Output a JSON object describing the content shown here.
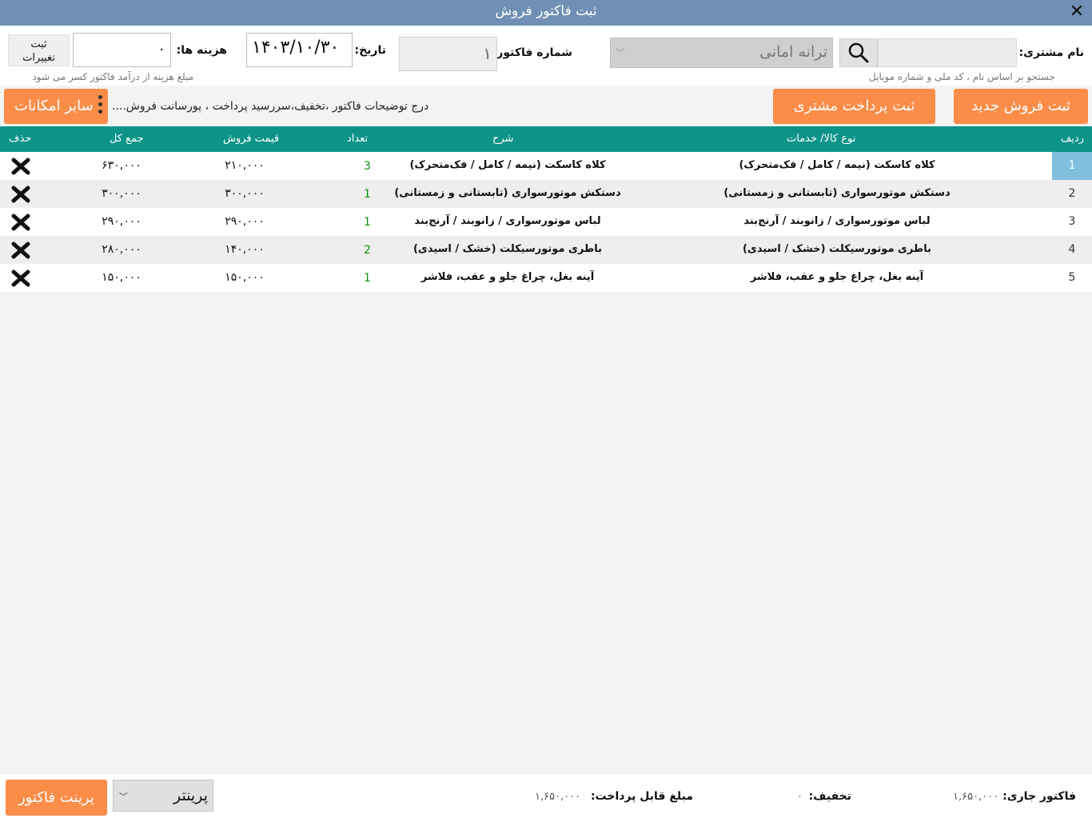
{
  "window": {
    "title": "ثبت فاکتور فروش",
    "close_label": "✕"
  },
  "customer": {
    "label": "نام مشتری:",
    "search_value": "",
    "search_hint": "جستجو بر اساس نام ، کد ملی و شماره موبایل",
    "selected": "ترانه امانی"
  },
  "invoice": {
    "number_label": "شماره فاکتور:",
    "number": "۱"
  },
  "date": {
    "label": "تاریخ:",
    "value": "۱۴۰۳/۱۰/۳۰"
  },
  "costs": {
    "label": "هزینه ها:",
    "value": "۰",
    "hint": "مبلغ هزینه از درآمد فاکتور کسر می شود"
  },
  "save_changes": {
    "line1": "ثبت",
    "line2": "تغییرات"
  },
  "actions": {
    "new_sale": "ثبت فروش جدید",
    "customer_payment": "ثبت پرداخت مشتری",
    "description": "درج توضیحات فاکتور ،تخفیف،سررسید پرداخت ، پورسانت فروش....",
    "more_options": "سایر امکانات"
  },
  "table": {
    "headers": {
      "row": "ردیف",
      "type": "نوع کالا/ خدمات",
      "desc": "شرح",
      "qty": "تعداد",
      "price": "قیمت فروش",
      "total": "جمع کل",
      "delete": "حذف"
    },
    "rows": [
      {
        "idx": "1",
        "type": "کلاه کاسکت (نیمه / کامل / فک‌متحرک)",
        "desc": "کلاه کاسکت (نیمه / کامل / فک‌متحرک)",
        "qty": "3",
        "price": "۲۱۰,۰۰۰",
        "total": "۶۳۰,۰۰۰"
      },
      {
        "idx": "2",
        "type": "دستکش موتورسواری (تابستانی و زمستانی)",
        "desc": "دستکش موتورسواری (تابستانی و زمستانی)",
        "qty": "1",
        "price": "۳۰۰,۰۰۰",
        "total": "۳۰۰,۰۰۰"
      },
      {
        "idx": "3",
        "type": "لباس موتورسواری / زانوبند / آرنج‌بند",
        "desc": "لباس موتورسواری / زانوبند / آرنج‌بند",
        "qty": "1",
        "price": "۲۹۰,۰۰۰",
        "total": "۲۹۰,۰۰۰"
      },
      {
        "idx": "4",
        "type": "باطری موتورسیکلت (خشک / اسیدی)",
        "desc": "باطری موتورسیکلت (خشک / اسیدی)",
        "qty": "2",
        "price": "۱۴۰,۰۰۰",
        "total": "۲۸۰,۰۰۰"
      },
      {
        "idx": "5",
        "type": "آینه بغل، چراغ جلو و عقب، فلاشر",
        "desc": "آینه بغل، چراغ جلو و عقب، فلاشر",
        "qty": "1",
        "price": "۱۵۰,۰۰۰",
        "total": "۱۵۰,۰۰۰"
      }
    ]
  },
  "footer": {
    "current_label": "فاکتور جاری:",
    "current_value": "۱,۶۵۰,۰۰۰",
    "discount_label": "تخفیف:",
    "discount_value": "۰",
    "payable_label": "مبلغ قابل پرداخت:",
    "payable_value": "۱,۶۵۰,۰۰۰",
    "printer": "پرینتر",
    "print_button": "پرینت فاکتور"
  },
  "colors": {
    "titlebar": "#6f90b4",
    "accent_orange": "#fb8d48",
    "table_header": "#0d9487",
    "selected_row": "#7fbfdc"
  }
}
